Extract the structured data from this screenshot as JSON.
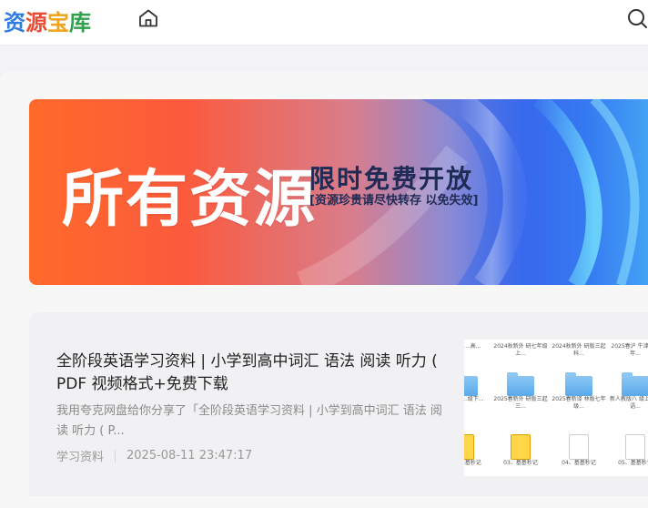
{
  "header": {
    "logo": [
      "资",
      "源",
      "宝",
      "库"
    ],
    "logo_colors": [
      "#2f7de1",
      "#ea4b35",
      "#f0a21b",
      "#2fa04b"
    ],
    "home_icon": "home-icon",
    "search_icon": "search-icon"
  },
  "banner": {
    "headline": "所有资源",
    "slogan": "限时免费开放",
    "note": "[资源珍贵请尽快转存 以免失效]"
  },
  "post": {
    "title": "全阶段英语学习资料 | 小学到高中词汇 语法 阅读 听力 ( PDF 视频格式+免费下载",
    "excerpt": "我用夸克网盘给你分享了「全阶段英语学习资料 | 小学到高中词汇 语法 阅读 听力 ( P...",
    "category": "学习资料",
    "date": "2025-08-11 23:47:17",
    "thumbnail": {
      "row1": [
        "...新人 ...高...",
        "2024秋新外 研七年级上...",
        "2024秋新外 研版三起科...",
        "2025春沪 牛津版七年..."
      ],
      "row2": [
        "...新外 ...级下...",
        "2025春新外 研版三起三...",
        "2025春新译 林版七年级...",
        "新人教版八 级上册英语..."
      ],
      "row3": [
        "03、基基秒记",
        "04、基基秒记",
        "05、基基秒记"
      ]
    }
  }
}
